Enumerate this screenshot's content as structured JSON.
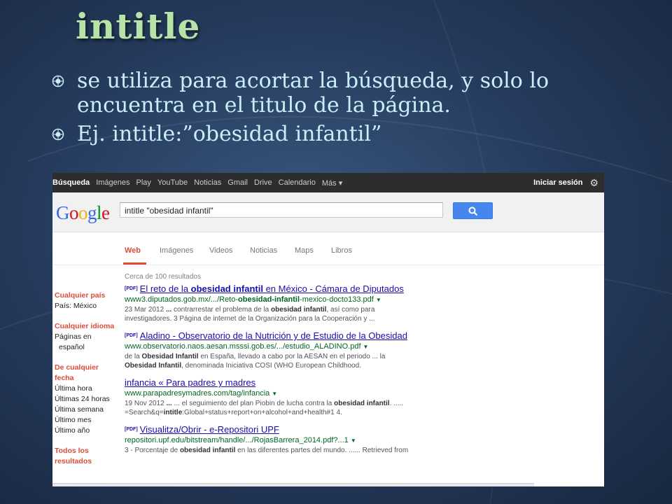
{
  "slide": {
    "title": "intitle",
    "bullets": [
      "se utiliza para acortar la búsqueda, y solo lo encuentra en el titulo de la página.",
      "Ej.  intitle:”obesidad infantil”"
    ]
  },
  "google": {
    "bar_items": [
      "Búsqueda",
      "Imágenes",
      "Play",
      "YouTube",
      "Noticias",
      "Gmail",
      "Drive",
      "Calendario",
      "Más ▾"
    ],
    "sign_in": "Iniciar sesión",
    "logo_letters": [
      "G",
      "o",
      "o",
      "g",
      "l",
      "e"
    ],
    "logo_colors": [
      "#3369e8",
      "#d50f25",
      "#eeb211",
      "#3369e8",
      "#009925",
      "#d50f25"
    ],
    "query": "intitle \"obesidad infantil\"",
    "tabs": [
      "Web",
      "Imágenes",
      "Videos",
      "Noticias",
      "Maps",
      "Libros"
    ],
    "result_count": "Cerca de 100 resultados",
    "sidebar": [
      {
        "heading": "Cualquier país",
        "items": [
          "País: México"
        ]
      },
      {
        "heading": "Cualquier idioma",
        "items": [
          "Páginas en",
          "español"
        ]
      },
      {
        "heading": "De cualquier fecha",
        "items": [
          "Última hora",
          "Últimas 24 horas",
          "Última semana",
          "Último mes",
          "Último año"
        ]
      },
      {
        "heading": "Todos los resultados",
        "items": []
      }
    ],
    "results": [
      {
        "tag": "[PDF]",
        "title_parts": [
          "El reto de la ",
          "obesidad infantil",
          " en México - Cámara de Diputados"
        ],
        "url_parts": [
          "www3.diputados.gob.mx/.../Reto-",
          "obesidad-infantil",
          "-mexico-docto133.pdf"
        ],
        "snippet_lines": [
          [
            "23 Mar 2012 ",
            "...",
            " contrarrestar el problema de la ",
            "obesidad infantil",
            ", así como para"
          ],
          [
            "investigadores. 3 Página de internet de la Organización para la Cooperación y ..."
          ]
        ]
      },
      {
        "tag": "[PDF]",
        "title_parts": [
          "Aladino - Observatorio de la Nutrición y de Estudio de la Obesidad"
        ],
        "url_parts": [
          "www.observatorio.naos.aesan.msssi.gob.es/.../estudio_ALADINO.pdf"
        ],
        "snippet_lines": [
          [
            "de la ",
            "Obesidad Infantil",
            " en España, llevado a cabo por la AESAN en el periodo ... la"
          ],
          [
            "Obesidad Infantil",
            ", denominada Iniciativa COSI (WHO European Childhood."
          ]
        ]
      },
      {
        "tag": "",
        "title_parts": [
          "infancia « Para padres y madres"
        ],
        "url_parts": [
          "www.parapadresymadres.com/tag/infancia"
        ],
        "snippet_lines": [
          [
            "19 Nov 2012 ",
            "...",
            " ... el seguimiento del plan Piobin de lucha contra la ",
            "obesidad infantil",
            ". ....."
          ],
          [
            "=Search&q=",
            "intitle",
            ":Global+status+report+on+alcohol+and+health#1 4."
          ]
        ]
      },
      {
        "tag": "[PDF]",
        "title_parts": [
          "Visualitza/Obrir - e-Repositori UPF"
        ],
        "url_parts": [
          "repositori.upf.edu/bitstream/handle/.../RojasBarrera_2014.pdf?...1"
        ],
        "snippet_lines": [
          [
            "3 - Porcentaje de ",
            "obesidad infantil",
            " en las diferentes partes del mundo. ...... Retrieved from"
          ]
        ]
      }
    ]
  }
}
